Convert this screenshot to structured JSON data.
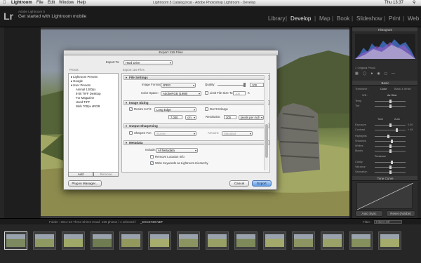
{
  "menubar": {
    "apple": "",
    "items": [
      "Lightroom",
      "File",
      "Edit",
      "Window",
      "Help"
    ],
    "title": "Lightroom 5 Catalog.lrcat - Adobe Photoshop Lightroom - Develop",
    "clock": "Thu 13:37"
  },
  "topbar": {
    "logo": "Lr",
    "product": "Adobe Lightroom 5",
    "promo": "Get started with Lightroom mobile",
    "modules": [
      "Library",
      "Develop",
      "Map",
      "Book",
      "Slideshow",
      "Print",
      "Web"
    ],
    "separator": "|"
  },
  "right_panel": {
    "histogram_label": "Histogram",
    "original_photo": "Original Photo",
    "basic_label": "Basic",
    "treatment": "Treatment :",
    "color": "Color",
    "bw": "Black & White",
    "wb": "WB :",
    "as_shot": "As Shot",
    "tone_label": "Tone",
    "auto": "Auto",
    "presence_label": "Presence",
    "sliders": [
      {
        "label": "Temp",
        "value": "",
        "pos": 0.5
      },
      {
        "label": "Tint",
        "value": "",
        "pos": 0.52
      },
      {
        "label": "Exposure",
        "value": "0.00",
        "pos": 0.5
      },
      {
        "label": "Contrast",
        "value": "+ 45",
        "pos": 0.72
      },
      {
        "label": "Highlights",
        "value": "",
        "pos": 0.45
      },
      {
        "label": "Shadows",
        "value": "",
        "pos": 0.55
      },
      {
        "label": "Whites",
        "value": "",
        "pos": 0.5
      },
      {
        "label": "Blacks",
        "value": "",
        "pos": 0.5
      },
      {
        "label": "Clarity",
        "value": "",
        "pos": 0.55
      },
      {
        "label": "Vibrance",
        "value": "",
        "pos": 0.5
      },
      {
        "label": "Saturation",
        "value": "",
        "pos": 0.5
      }
    ],
    "tone_curve_label": "Tone Curve",
    "auto_sync": "Auto Sync",
    "reset": "Reset (Adobe)"
  },
  "filmstrip": {
    "info": "Folder : 2014-10 Three Shires Head",
    "count": "236 photos / 1 selected /",
    "filename": "_DSC3730.NEF",
    "filter": "Filter :",
    "filter_value": "Filters Off"
  },
  "dialog": {
    "title": "Export 116 Files",
    "export_to_label": "Export To:",
    "export_to_value": "Hard Drive",
    "preset_label": "Preset:",
    "preset_header": "Export 116 Files",
    "presets": [
      {
        "label": "Lightroom Presets",
        "indent": 1,
        "tri": "▸"
      },
      {
        "label": "Google",
        "indent": 1,
        "tri": "▸"
      },
      {
        "label": "User Presets",
        "indent": 1,
        "tri": "▾"
      },
      {
        "label": "Animal 1200px",
        "indent": 2,
        "tri": ""
      },
      {
        "label": "8-bit TIFF Desktop",
        "indent": 2,
        "tri": ""
      },
      {
        "label": "For Magazine",
        "indent": 2,
        "tri": ""
      },
      {
        "label": "Used TIFF",
        "indent": 2,
        "tri": ""
      },
      {
        "label": "Web 700px sRGB",
        "indent": 2,
        "tri": ""
      }
    ],
    "add": "Add",
    "remove": "Remove",
    "file_settings": "File Settings",
    "image_format_label": "Image Format:",
    "image_format": "JPEG",
    "quality_label": "Quality:",
    "quality": "100",
    "color_space_label": "Color Space:",
    "color_space": "AdobeRGB (1998)",
    "limit_size": "Limit File Size To:",
    "limit_value": "100",
    "limit_unit": "K",
    "image_sizing": "Image Sizing",
    "resize_label": "Resize to Fit:",
    "resize_value": "Long Edge",
    "dont_enlarge": "Don't Enlarge",
    "size_value": "7,000",
    "size_unit": "cm",
    "resolution_label": "Resolution:",
    "resolution": "300",
    "resolution_unit": "pixels per inch",
    "output_sharpening": "Output Sharpening",
    "sharpen_for": "Sharpen For:",
    "sharpen_value": "Screen",
    "amount_label": "Amount:",
    "amount_value": "Standard",
    "metadata": "Metadata",
    "include_label": "Include:",
    "include_value": "All Metadata",
    "remove_location": "Remove Location Info",
    "write_keywords": "Write Keywords as Lightroom Hierarchy",
    "check": "✓",
    "plugin_manager": "Plug-in Manager...",
    "cancel": "Cancel",
    "export": "Export"
  },
  "colors": {
    "accent": "#5f9de5",
    "panel": "#2c2c2c",
    "dialog": "#ececec"
  }
}
